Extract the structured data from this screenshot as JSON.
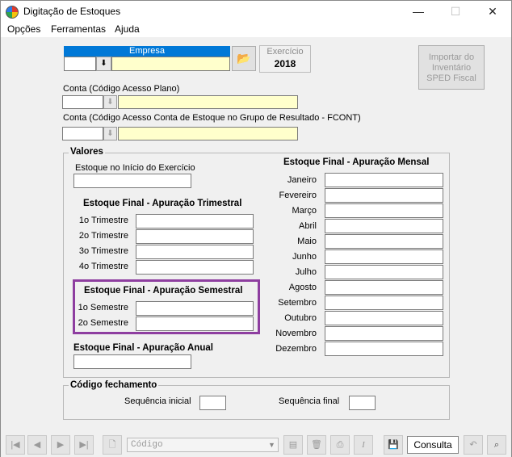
{
  "window": {
    "title": "Digitação de Estoques",
    "minimize": "—",
    "maximize": "☐",
    "close": "✕"
  },
  "menu": {
    "opcoes": "Opções",
    "ferramentas": "Ferramentas",
    "ajuda": "Ajuda"
  },
  "empresa": {
    "label": "Empresa",
    "code_value": "",
    "name_value": ""
  },
  "exercicio": {
    "label": "Exercício",
    "value": "2018"
  },
  "import_button": {
    "line1": "Importar do",
    "line2": "Inventário",
    "line3": "SPED Fiscal"
  },
  "conta": {
    "label": "Conta (Código Acesso Plano)",
    "code_value": "",
    "desc_value": ""
  },
  "conta_fcont": {
    "label": "Conta (Código Acesso Conta de Estoque no Grupo de Resultado - FCONT)",
    "code_value": "",
    "desc_value": ""
  },
  "valores": {
    "legend": "Valores",
    "inicio_label": "Estoque no Início do Exercício",
    "trimestral": {
      "title": "Estoque Final - Apuração Trimestral",
      "items": [
        "1o Trimestre",
        "2o Trimestre",
        "3o Trimestre",
        "4o Trimestre"
      ]
    },
    "semestral": {
      "title": "Estoque Final - Apuração Semestral",
      "items": [
        "1o Semestre",
        "2o Semestre"
      ]
    },
    "anual": {
      "title": "Estoque Final - Apuração Anual"
    },
    "mensal": {
      "title": "Estoque Final - Apuração Mensal",
      "months": [
        "Janeiro",
        "Fevereiro",
        "Março",
        "Abril",
        "Maio",
        "Junho",
        "Julho",
        "Agosto",
        "Setembro",
        "Outubro",
        "Novembro",
        "Dezembro"
      ]
    }
  },
  "fechamento": {
    "legend": "Código fechamento",
    "inicial_label": "Sequência inicial",
    "final_label": "Sequência final"
  },
  "toolbar": {
    "search_placeholder": "Código",
    "mode": "Consulta"
  },
  "colors": {
    "highlight_border": "#8e3ea0",
    "title_blue": "#0078d7",
    "yellow_field": "#ffffcc"
  }
}
